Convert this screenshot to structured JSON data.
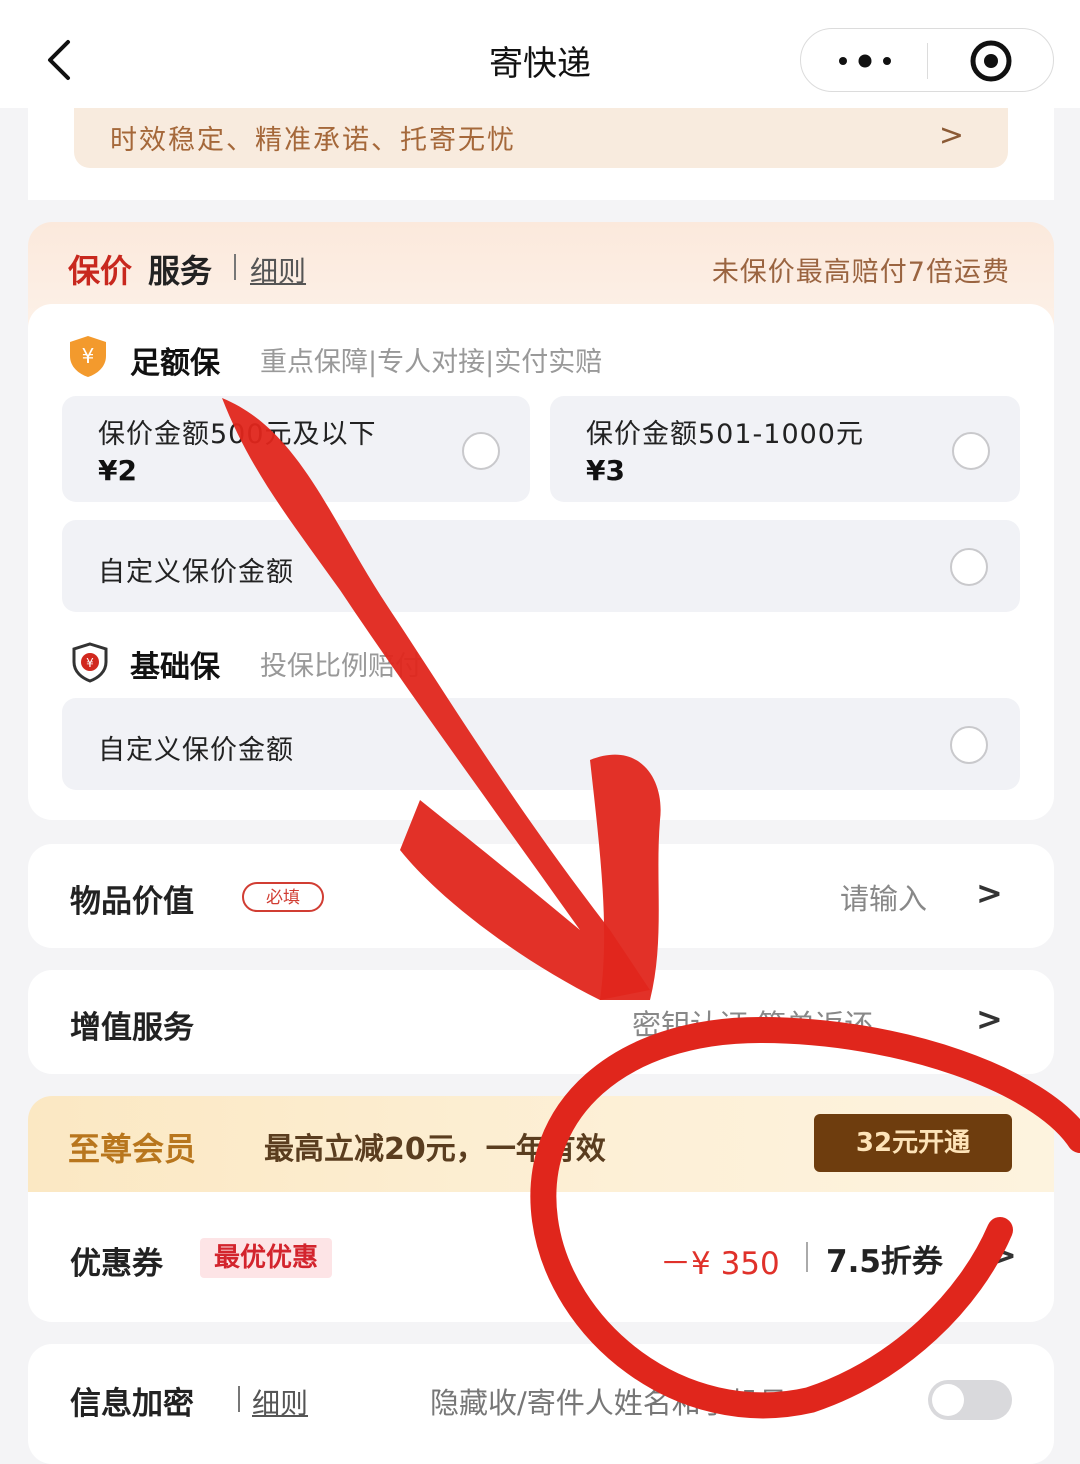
{
  "header": {
    "title": "寄快递",
    "back_icon": "chevron-left-icon",
    "more_icon": "more-dots-icon",
    "close_icon": "target-circle-icon"
  },
  "banner": {
    "text": "时效稳定、精准承诺、托寄无忧",
    "chevron": ">"
  },
  "insured": {
    "title_red": "保价",
    "title_black": "服务",
    "rules_link": "细则",
    "note": "未保价最高赔付7倍运费",
    "full_plan": {
      "icon": "yuan-shield-icon",
      "name": "足额保",
      "desc": "重点保障|专人对接|实付实赔",
      "options": [
        {
          "line1": "保价金额500元及以下",
          "line2": "¥2"
        },
        {
          "line1": "保价金额501-1000元",
          "line2": "¥3"
        }
      ],
      "custom_label": "自定义保价金额"
    },
    "basic_plan": {
      "icon": "yuan-shield-outline-icon",
      "name": "基础保",
      "desc": "投保比例赔付",
      "custom_label": "自定义保价金额"
    }
  },
  "item_value": {
    "label": "物品价值",
    "badge": "必填",
    "placeholder": "请输入",
    "chevron": ">"
  },
  "value_added": {
    "label": "增值服务",
    "value": "密钥认证 签单返还",
    "chevron": ">"
  },
  "member": {
    "title": "至尊会员",
    "desc": "最高立减20元，一年有效",
    "button": "32元开通"
  },
  "coupon": {
    "label": "优惠券",
    "tag": "最优优惠",
    "amount": "－¥ 350",
    "type": "7.5折券",
    "chevron": ">"
  },
  "info_encrypt": {
    "label": "信息加密",
    "rules_link": "细则",
    "desc": "隐藏收/寄件人姓名和手机号"
  },
  "colors": {
    "accent_red": "#c8281e",
    "annotation_red": "#e0261c",
    "member_brown": "#6e3d0e"
  }
}
